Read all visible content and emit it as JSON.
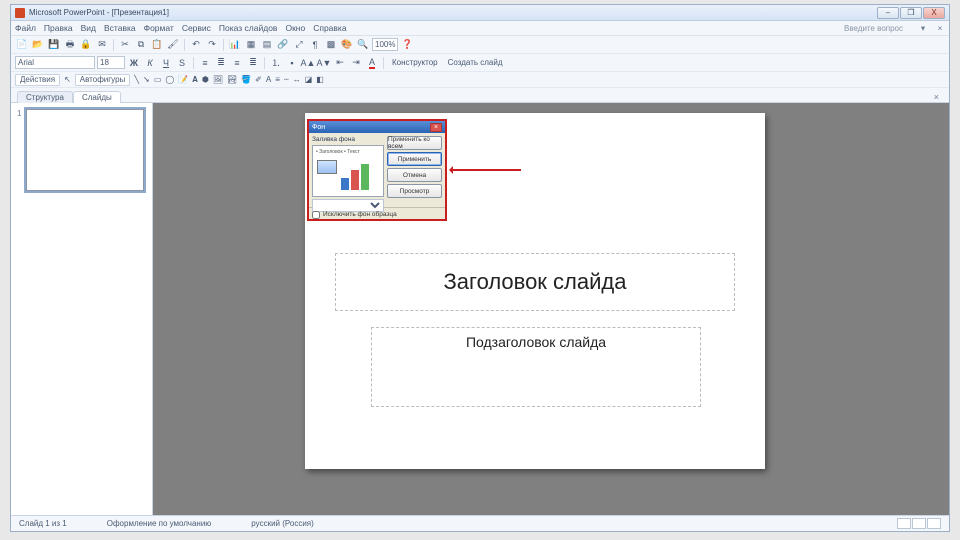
{
  "title": "Microsoft PowerPoint - [Презентация1]",
  "window": {
    "min": "–",
    "max": "❐",
    "close": "X"
  },
  "menu": [
    "Файл",
    "Правка",
    "Вид",
    "Вставка",
    "Формат",
    "Сервис",
    "Показ слайдов",
    "Окно",
    "Справка"
  ],
  "askbox": "Введите вопрос",
  "zoom": "100%",
  "font": {
    "name": "Arial",
    "size": "18"
  },
  "toolbar3": {
    "actions": "Действия",
    "autoshapes": "Автофигуры"
  },
  "format_row": {
    "design": "Конструктор",
    "newslide": "Создать слайд"
  },
  "tabs": {
    "outline": "Структура",
    "slides": "Слайды"
  },
  "thumb": {
    "index": "1"
  },
  "slide": {
    "title": "Заголовок слайда",
    "subtitle": "Подзаголовок слайда"
  },
  "dialog": {
    "title": "Фон",
    "section": "Заливка фона",
    "preview_caption": "• Заголовок\n• Текст",
    "buttons": {
      "apply_all": "Применить ко всем",
      "apply": "Применить",
      "cancel": "Отмена",
      "preview": "Просмотр"
    },
    "checkbox": "Исключить фон образца"
  },
  "status": {
    "slide": "Слайд 1 из 1",
    "design": "Оформление по умолчанию",
    "lang": "русский (Россия)"
  }
}
